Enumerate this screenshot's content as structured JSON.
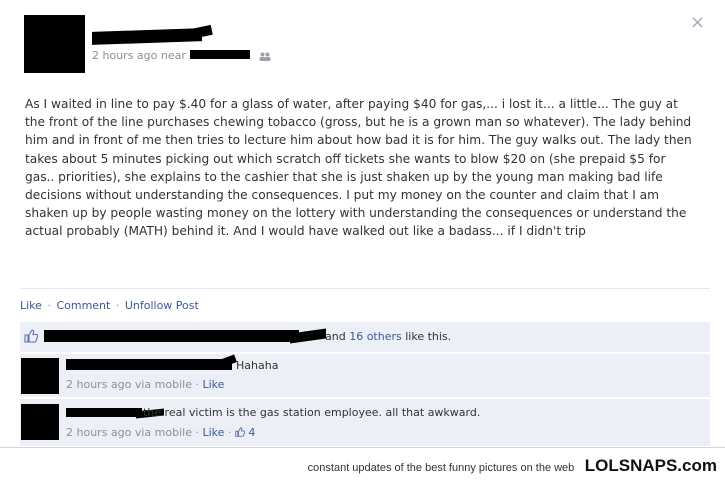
{
  "post": {
    "meta": "2 hours ago near",
    "body": "As I waited in line to pay $.40 for a glass of water, after paying $40 for gas,... i lost it... a little... The guy at the front of the line purchases chewing tobacco (gross, but he is a grown man so whatever). The lady behind him and in front of me then tries to lecture him about how bad it is for him. The guy walks out. The lady then takes about 5 minutes picking out which scratch off tickets she wants to blow $20 on (she prepaid $5 for gas.. priorities), she explains to the cashier that she is just shaken up by the young man making bad life decisions without understanding the consequences. I put my money on the counter and claim that I am shaken up by people wasting money on the lottery with understanding the consequences or understand the actual probably (MATH) behind it. And I would have walked out like a badass... if I didn't trip",
    "close_glyph": "×"
  },
  "actions": {
    "like": "Like",
    "comment": "Comment",
    "unfollow": "Unfollow Post",
    "separator": "·"
  },
  "likes": {
    "and": "and",
    "others": "16 others",
    "suffix": "like this."
  },
  "comments": [
    {
      "text": "Hahaha",
      "time": "2 hours ago via mobile",
      "like": "Like",
      "like_count": ""
    },
    {
      "text": "the real victim is the gas station employee. all that awkward.",
      "time": "2 hours ago via mobile",
      "like": "Like",
      "like_count": "4"
    }
  ],
  "footer": {
    "tagline": "constant updates of the best funny pictures on the web",
    "brand": "LOLSNAPS.com"
  },
  "colors": {
    "link": "#3b5998",
    "meta": "#8a8f9a",
    "comment_bg": "#eceff5"
  },
  "icons": [
    "close-icon",
    "people-icon",
    "thumbs-up-icon"
  ]
}
